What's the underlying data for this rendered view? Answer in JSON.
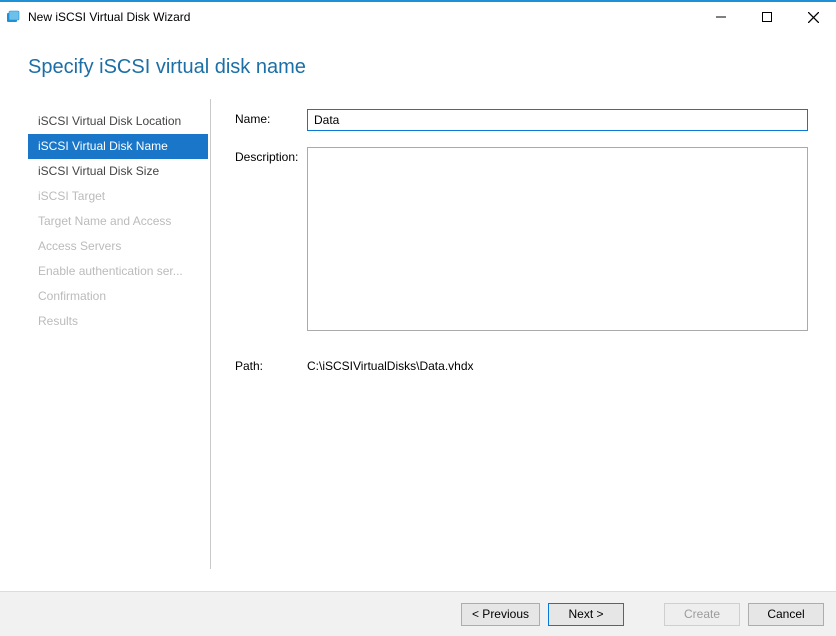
{
  "window": {
    "title": "New iSCSI Virtual Disk Wizard"
  },
  "heading": "Specify iSCSI virtual disk name",
  "sidebar": {
    "items": [
      {
        "label": "iSCSI Virtual Disk Location",
        "state": "normal"
      },
      {
        "label": "iSCSI Virtual Disk Name",
        "state": "selected"
      },
      {
        "label": "iSCSI Virtual Disk Size",
        "state": "normal"
      },
      {
        "label": "iSCSI Target",
        "state": "disabled"
      },
      {
        "label": "Target Name and Access",
        "state": "disabled"
      },
      {
        "label": "Access Servers",
        "state": "disabled"
      },
      {
        "label": "Enable authentication ser...",
        "state": "disabled"
      },
      {
        "label": "Confirmation",
        "state": "disabled"
      },
      {
        "label": "Results",
        "state": "disabled"
      }
    ]
  },
  "form": {
    "name_label": "Name:",
    "name_value": "Data",
    "description_label": "Description:",
    "description_value": "",
    "path_label": "Path:",
    "path_value": "C:\\iSCSIVirtualDisks\\Data.vhdx"
  },
  "footer": {
    "previous": "< Previous",
    "next": "Next >",
    "create": "Create",
    "cancel": "Cancel"
  }
}
